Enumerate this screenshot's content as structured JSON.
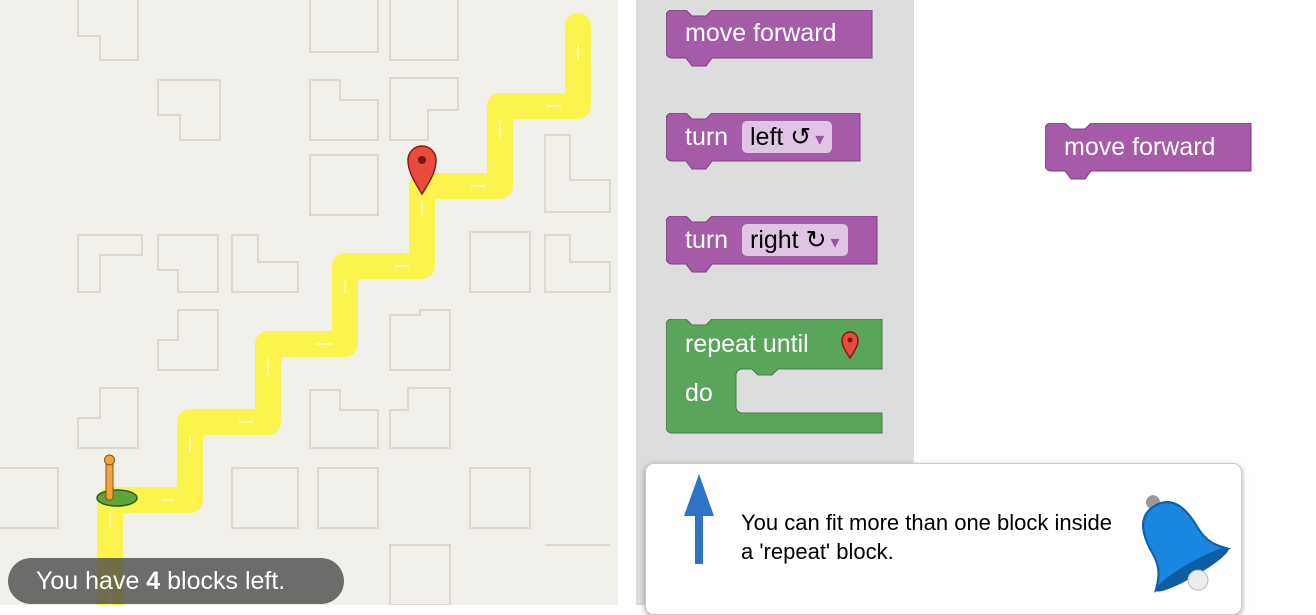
{
  "maze": {
    "start_icon": "pegman-flag-icon",
    "goal_icon": "map-marker-icon"
  },
  "status": {
    "prefix": "You have ",
    "count": "4",
    "suffix": " blocks left."
  },
  "toolbox": {
    "move_forward_label": "move forward",
    "turn_left": {
      "label": "turn",
      "value": "left ↺",
      "arrow": "▾"
    },
    "turn_right": {
      "label": "turn",
      "value": "right ↻",
      "arrow": "▾"
    },
    "repeat": {
      "label": "repeat until",
      "do_label": "do",
      "icon": "map-marker-icon"
    }
  },
  "workspace": {
    "move_forward_label": "move forward"
  },
  "hint": {
    "text": "You can fit more than one block inside a 'repeat' block.",
    "arrow_icon": "up-arrow-icon",
    "bell_icon": "bell-icon"
  },
  "colors": {
    "action_block": "#a55ba8",
    "loop_block": "#5ba55b",
    "path": "#fcf34c",
    "maze_bg": "#f1efe9",
    "toolbox_bg": "#dddddd"
  }
}
